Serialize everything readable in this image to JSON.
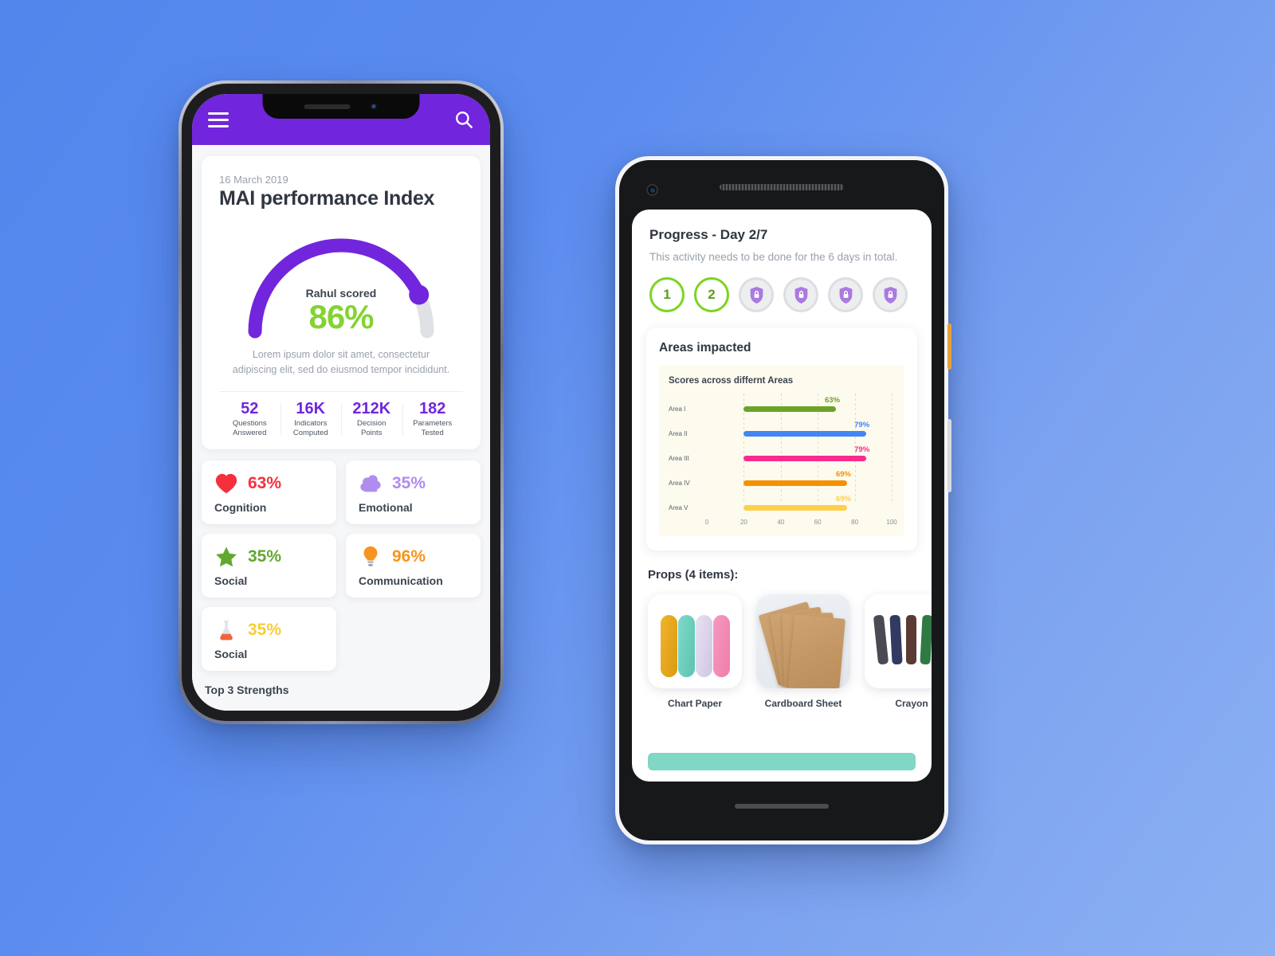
{
  "background": {
    "color_start": "#5286ec",
    "color_end": "#8cb0f2"
  },
  "phone_left": {
    "device": "iphone",
    "appbar": {
      "background": "#7126dd",
      "menu_icon": "hamburger-menu-icon",
      "search_icon": "search-icon"
    },
    "hero": {
      "date": "16 March 2019",
      "title": "MAI performance Index",
      "gauge": {
        "label": "Rahul scored",
        "value": "86%",
        "percent": 86,
        "arc_color": "#7126dd",
        "track_color": "#dfe1e5",
        "value_color": "#84d331"
      },
      "description": "Lorem ipsum dolor sit amet, consectetur adipiscing elit, sed do eiusmod tempor incididunt.",
      "stats": [
        {
          "number": "52",
          "label": "Questions Answered"
        },
        {
          "number": "16K",
          "label": "Indicators Computed"
        },
        {
          "number": "212K",
          "label": "Decision Points"
        },
        {
          "number": "182",
          "label": "Parameters Tested"
        }
      ],
      "stat_color": "#7126dd"
    },
    "metrics": [
      {
        "icon": "heart-icon",
        "percent": "63%",
        "name": "Cognition",
        "color": "#f4303c"
      },
      {
        "icon": "brain-cloud-icon",
        "percent": "35%",
        "name": "Emotional",
        "color": "#b18cf0"
      },
      {
        "icon": "star-icon",
        "percent": "35%",
        "name": "Social",
        "color": "#62a830"
      },
      {
        "icon": "lightbulb-icon",
        "percent": "96%",
        "name": "Communication",
        "color": "#f7941e"
      },
      {
        "icon": "flask-icon",
        "percent": "35%",
        "name": "Social",
        "color": "#f7ce36"
      }
    ],
    "strengths_heading": "Top 3 Strengths"
  },
  "phone_right": {
    "device": "pixel",
    "header": {
      "title": "Progress - Day 2/7",
      "subtitle": "This activity needs to be done for the 6 days in total."
    },
    "days": [
      {
        "label": "1",
        "state": "done"
      },
      {
        "label": "2",
        "state": "done"
      },
      {
        "label": "",
        "state": "locked"
      },
      {
        "label": "",
        "state": "locked"
      },
      {
        "label": "",
        "state": "locked"
      },
      {
        "label": "",
        "state": "locked"
      }
    ],
    "impact": {
      "title": "Areas impacted"
    },
    "props": {
      "heading": "Props (4 items):",
      "items": [
        {
          "name": "Chart Paper",
          "art": "paper-rolls"
        },
        {
          "name": "Cardboard Sheet",
          "art": "cardboard-sheets"
        },
        {
          "name": "Crayon",
          "art": "crayons"
        }
      ]
    },
    "cta_color": "#7fd7c4"
  },
  "chart_data": {
    "type": "bar",
    "orientation": "horizontal",
    "title": "Scores across differnt Areas",
    "categories": [
      "Area I",
      "Area II",
      "Area III",
      "Area IV",
      "Area V"
    ],
    "values": [
      63,
      79,
      79,
      69,
      69
    ],
    "labels": [
      "63%",
      "79%",
      "79%",
      "69%",
      "69%"
    ],
    "colors": [
      "#6aa329",
      "#4285f4",
      "#f72b8f",
      "#f59100",
      "#fbd050"
    ],
    "bar_start": 20,
    "xlabel": "",
    "ylabel": "",
    "xlim": [
      0,
      100
    ],
    "xticks": [
      "0",
      "20",
      "40",
      "60",
      "80",
      "100"
    ],
    "grid": true,
    "legend": false,
    "plot_background": "#fdfaee"
  }
}
